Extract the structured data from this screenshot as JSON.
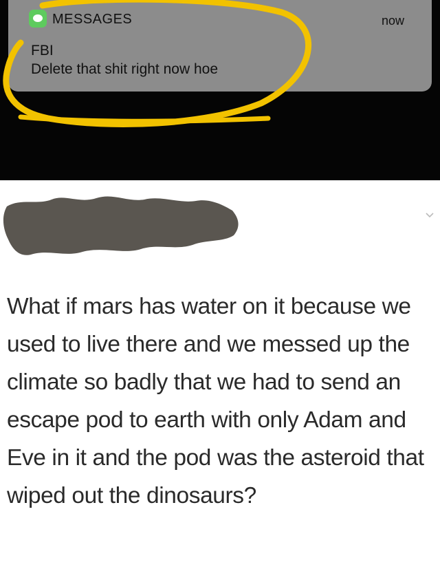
{
  "notification": {
    "app_name": "MESSAGES",
    "time": "now",
    "sender": "FBI",
    "message": "Delete that shit right now hoe",
    "app_icon": "messages-app-icon"
  },
  "post": {
    "author_redacted": true,
    "chevron_icon": "chevron-down-icon",
    "body": "What if mars has water on it because we used to live there and we messed up the climate so badly that we had to send an escape pod to earth with only Adam and Eve in it and the pod was the asteroid that wiped out the dinosaurs?"
  },
  "colors": {
    "notification_bg": "#8c8c8c",
    "highlight_circle": "#f2c200",
    "redaction": "#5a5650"
  }
}
